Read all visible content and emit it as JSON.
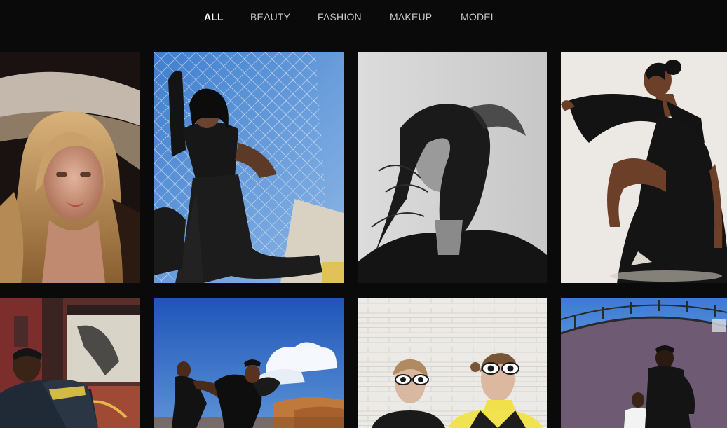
{
  "filters": {
    "items": [
      "ALL",
      "BEAUTY",
      "FASHION",
      "MAKEUP",
      "MODEL"
    ],
    "active_index": 0
  },
  "colors": {
    "background": "#0a0a0a",
    "filter_text": "#c9c9c9",
    "filter_active_text": "#ffffff"
  },
  "gallery": {
    "photos": [
      "photo-blonde-woman-under-hat-brim",
      "photo-woman-leather-outfit-by-chain-fence",
      "photo-bw-woman-hair-blowing",
      "photo-woman-black-bell-sleeve-dress",
      "photo-man-by-graffiti-wall",
      "photo-couple-dancing-blue-sky",
      "photo-two-women-white-sunglasses",
      "photo-two-men-by-purple-tank"
    ]
  }
}
